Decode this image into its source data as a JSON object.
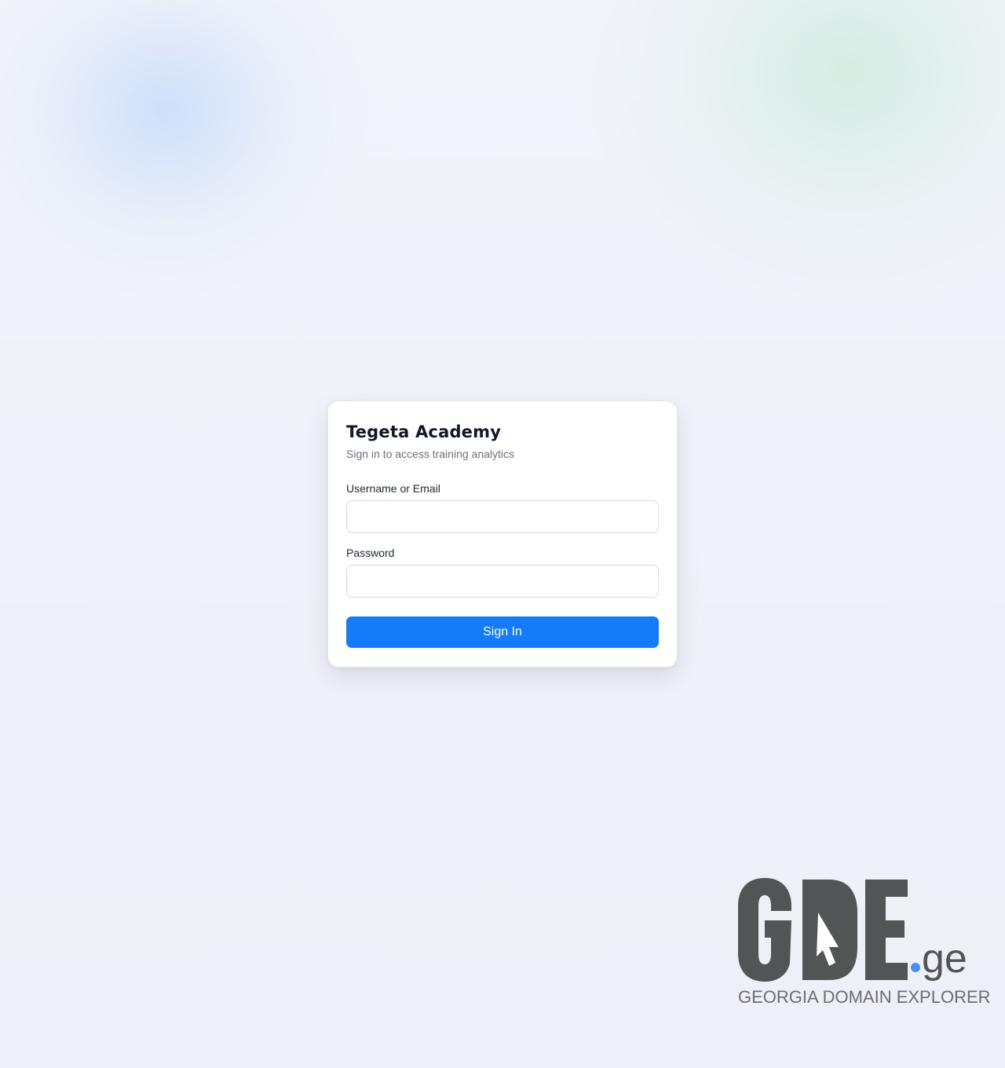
{
  "login_card": {
    "title": "Tegeta Academy",
    "subtitle": "Sign in to access training analytics",
    "username_label": "Username or Email",
    "username_value": "",
    "password_label": "Password",
    "password_value": "",
    "submit_label": "Sign In"
  },
  "watermark": {
    "logo_text": "GDE.ge",
    "tagline": "GEORGIA DOMAIN EXPLORER"
  },
  "colors": {
    "accent": "#147cfb",
    "logo_gray": "#535456",
    "logo_dot": "#4a90f5"
  }
}
